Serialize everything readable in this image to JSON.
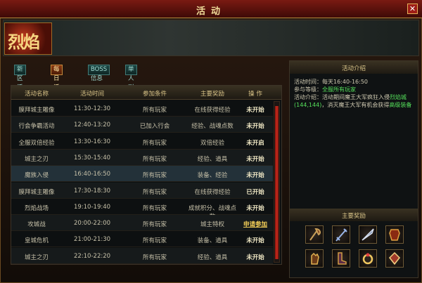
{
  "window": {
    "title": "活动",
    "close_glyph": "✕"
  },
  "logo": {
    "text": "烈焰"
  },
  "tabs": [
    {
      "label": "新区活动",
      "active": false
    },
    {
      "label": "每日活动",
      "active": true
    },
    {
      "label": "BOSS信息",
      "active": false
    },
    {
      "label": "单人副本",
      "active": false
    }
  ],
  "table": {
    "headers": [
      "活动名称",
      "活动时间",
      "参加条件",
      "主要奖励",
      "操 作"
    ],
    "rows": [
      [
        "膜拜城主雕像",
        "11:30-12:30",
        "所有玩家",
        "在线获得经验",
        "未开始"
      ],
      [
        "行会争霸活动",
        "12:40-13:20",
        "已加入行会",
        "经验、战魂点数",
        "未开始"
      ],
      [
        "全服双倍经验",
        "13:30-16:30",
        "所有玩家",
        "双倍经验",
        "未开启"
      ],
      [
        "城主之刃",
        "15:30-15:40",
        "所有玩家",
        "经验、道具",
        "未开始"
      ],
      [
        "魔族入侵",
        "16:40-16:50",
        "所有玩家",
        "装备、经验",
        "未开始"
      ],
      [
        "膜拜城主雕像",
        "17:30-18:30",
        "所有玩家",
        "在线获得经验",
        "已开始"
      ],
      [
        "烈焰战场",
        "19:10-19:40",
        "所有玩家",
        "成就积分、战魂点数",
        "未开始"
      ],
      [
        "攻城战",
        "20:00-22:00",
        "所有玩家",
        "城主特权",
        "申请参加"
      ],
      [
        "皇城危机",
        "21:00-21:30",
        "所有玩家",
        "装备、道具",
        "未开始"
      ],
      [
        "城主之刃",
        "22:10-22:20",
        "所有玩家",
        "经验、道具",
        "未开始"
      ]
    ]
  },
  "intro": {
    "title": "活动介绍",
    "time_label": "活动时间：",
    "time_value": "每天16:40-16:50",
    "level_label": "参与等级：",
    "level_value": "全服所有玩家",
    "desc_label": "活动介绍：",
    "desc_text": "活动期间魔王大军疯狂入侵",
    "desc_place": "烈焰城(144,144)",
    "desc_text2": "，消灭魔王大军有机会获得",
    "desc_reward": "高级装备"
  },
  "rewards": {
    "title": "主要奖励",
    "items": [
      "axe-icon",
      "sword-icon",
      "blade-icon",
      "armor-icon",
      "gloves-icon",
      "boots-icon",
      "ring-icon",
      "gem-icon"
    ]
  },
  "colors": {
    "accent": "#c58a3c",
    "highlight_row": "#233139",
    "green": "#55e05b"
  }
}
